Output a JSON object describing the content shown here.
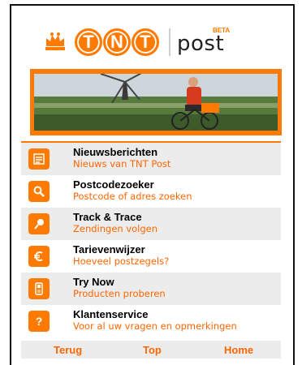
{
  "header": {
    "logo_letters": [
      "T",
      "N",
      "T"
    ],
    "brand_suffix": "post",
    "beta_label": "BETA",
    "logo_color": "#ff7a00"
  },
  "banner": {
    "image_icon": "cyclist-windmill-photo"
  },
  "menu": {
    "items": [
      {
        "title": "Nieuwsberichten",
        "subtitle": "Nieuws van TNT Post",
        "icon": "news-icon"
      },
      {
        "title": "Postcodezoeker",
        "subtitle": "Postcode of adres zoeken",
        "icon": "search-icon"
      },
      {
        "title": "Track & Trace",
        "subtitle": "Zendingen volgen",
        "icon": "pin-icon"
      },
      {
        "title": "Tarievenwijzer",
        "subtitle": "Hoeveel postzegels?",
        "icon": "euro-icon"
      },
      {
        "title": "Try Now",
        "subtitle": "Producten proberen",
        "icon": "phone-icon"
      },
      {
        "title": "Klantenservice",
        "subtitle": "Voor al uw vragen en opmerkingen",
        "icon": "question-icon"
      }
    ]
  },
  "footer": {
    "back_label": "Terug",
    "top_label": "Top",
    "home_label": "Home"
  },
  "colors": {
    "accent": "#ff7a00",
    "link": "#ff6600",
    "row_alt": "#ececec"
  }
}
